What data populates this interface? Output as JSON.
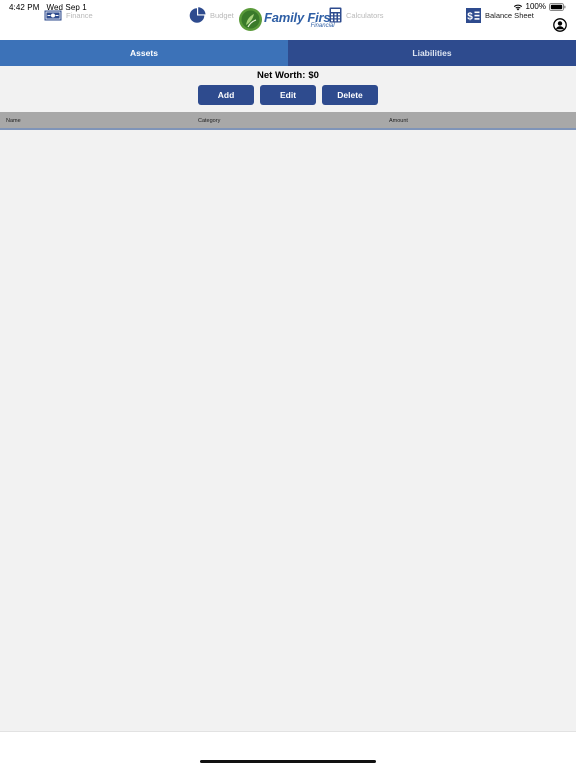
{
  "status_bar": {
    "time": "4:42 PM",
    "date": "Wed Sep 1",
    "battery": "100%",
    "wifi_icon": "wifi-icon",
    "battery_icon": "battery-icon"
  },
  "header": {
    "logo_title": "Family First",
    "logo_subtitle": "Financial",
    "profile_icon": "person-circle-icon"
  },
  "tabs": [
    {
      "label": "Assets",
      "selected": true
    },
    {
      "label": "Liabilities",
      "selected": false
    }
  ],
  "summary": {
    "net_worth_label": "Net Worth:",
    "net_worth_value": "$0"
  },
  "actions": {
    "add_label": "Add",
    "edit_label": "Edit",
    "delete_label": "Delete"
  },
  "table": {
    "columns": [
      "Name",
      "Category",
      "Amount"
    ],
    "rows": []
  },
  "tab_bar": {
    "items": [
      {
        "label": "Finance",
        "icon": "money-bill-icon",
        "selected": false
      },
      {
        "label": "Budget",
        "icon": "pie-chart-icon",
        "selected": false
      },
      {
        "label": "Calculators",
        "icon": "calculator-icon",
        "selected": false
      },
      {
        "label": "Balance Sheet",
        "icon": "balance-sheet-icon",
        "selected": true
      }
    ]
  },
  "colors": {
    "primary": "#2e4b8e",
    "tab_active": "#3c72b8",
    "table_header": "#a8a8a8",
    "background": "#f2f2f2",
    "logo_green": "#5a9a3a"
  }
}
